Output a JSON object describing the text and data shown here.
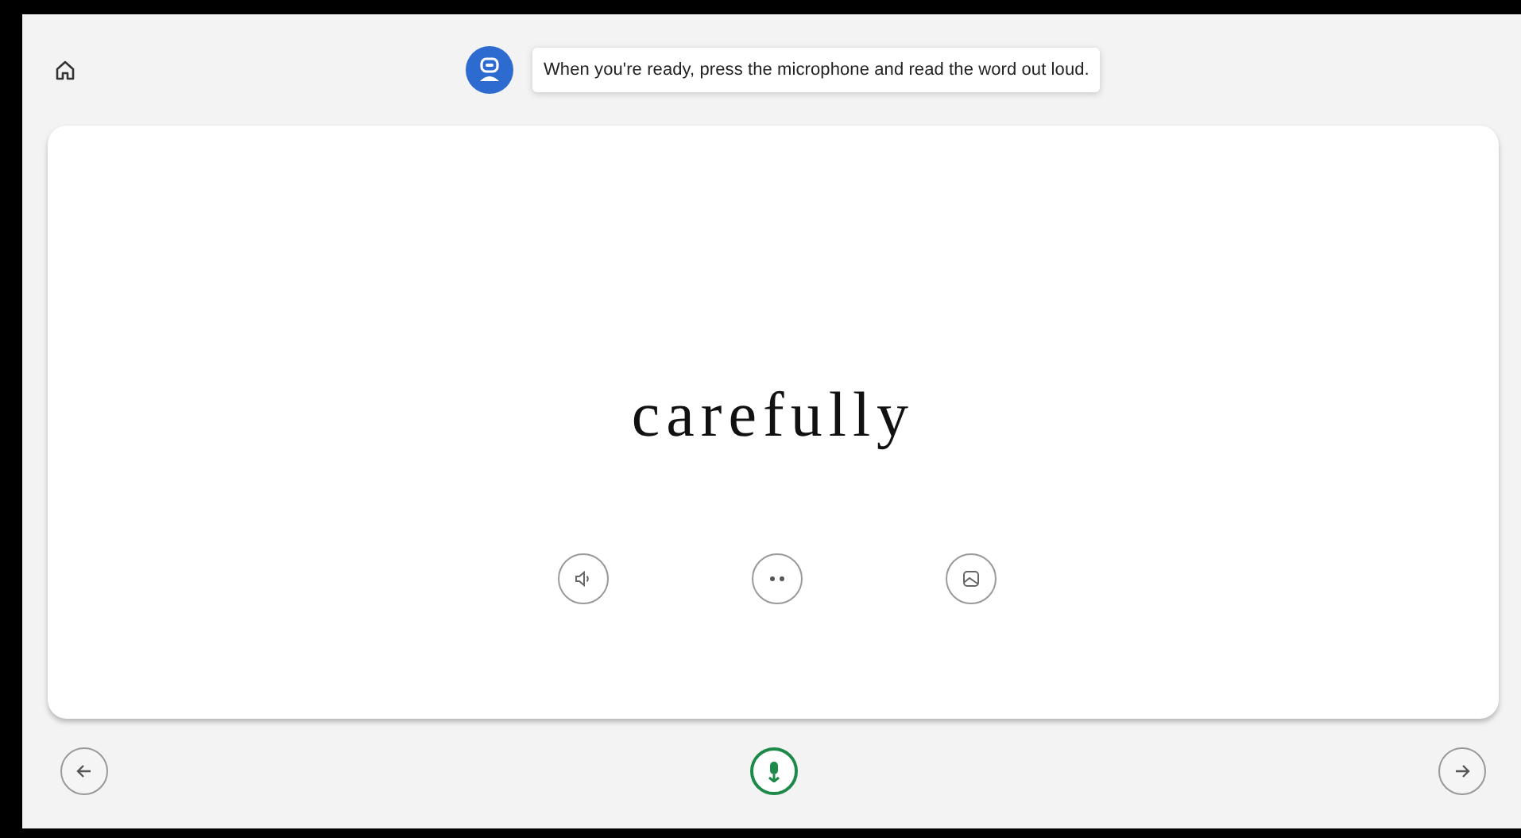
{
  "assistant": {
    "message": "When you're ready, press the microphone and read the word out loud."
  },
  "card": {
    "word": "carefully"
  }
}
